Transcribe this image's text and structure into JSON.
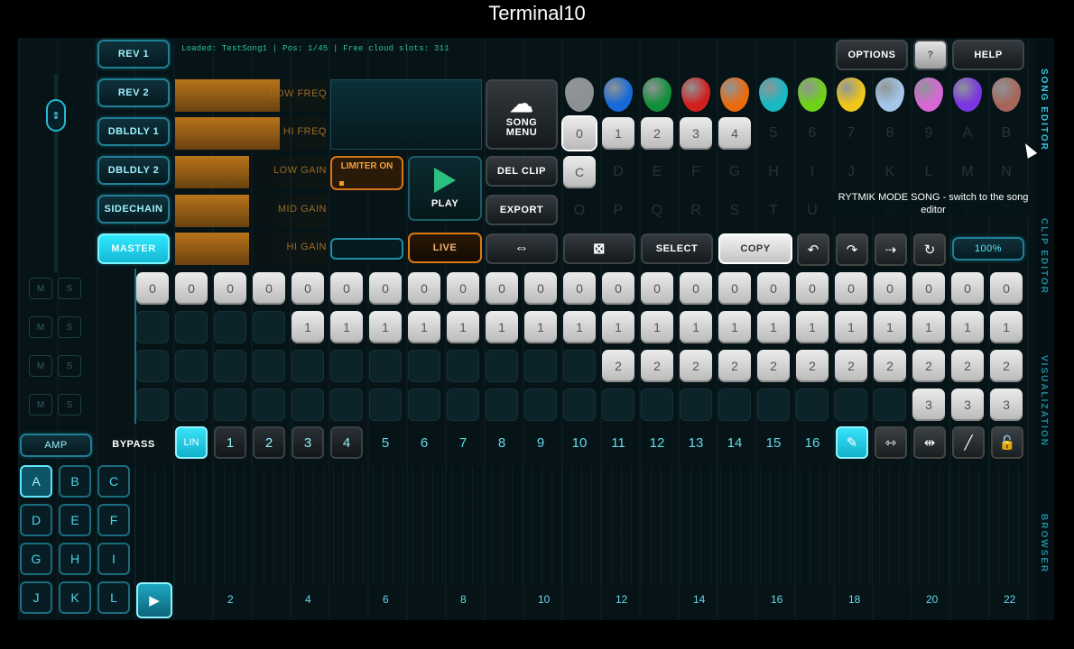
{
  "window_title": "Terminal10",
  "status_line": "Loaded: TestSong1 | Pos: 1/45 | Free cloud slots: 311",
  "effects": [
    "REV 1",
    "REV 2",
    "DBLDLY 1",
    "DBLDLY 2",
    "SIDECHAIN",
    "MASTER"
  ],
  "faders": [
    {
      "label": "LOW FREQ",
      "level": 0.69
    },
    {
      "label": "HI FREQ",
      "level": 0.69
    },
    {
      "label": "LOW GAIN",
      "level": 0.49
    },
    {
      "label": "MID GAIN",
      "level": 0.49
    },
    {
      "label": "HI GAIN",
      "level": 0.49
    }
  ],
  "limiter_label": "LIMITER ON",
  "song_menu": "SONG MENU",
  "play": "PLAY",
  "live": "LIVE",
  "del_clip": "DEL CLIP",
  "export": "EXPORT",
  "options": "OPTIONS",
  "question": "?",
  "help": "HELP",
  "select": "SELECT",
  "copy": "COPY",
  "zoom": "100%",
  "tooltip": "RYTMIK MODE SONG - switch to the song editor",
  "pick_colors": [
    "#8e9194",
    "#1669d8",
    "#138f3a",
    "#d0211f",
    "#ea6a0e",
    "#17b9c3",
    "#6fd11a",
    "#efc619",
    "#a4c6e8",
    "#d867d6",
    "#7a35e0",
    "#a7655a"
  ],
  "clip_row1": [
    "0",
    "1",
    "2",
    "3",
    "4",
    "5",
    "6",
    "7",
    "8",
    "9",
    "A",
    "B"
  ],
  "clip_row2": [
    "C",
    "D",
    "E",
    "F",
    "G",
    "H",
    "I",
    "J",
    "K",
    "L",
    "M",
    "N"
  ],
  "clip_row3": [
    "O",
    "P",
    "Q",
    "R",
    "S",
    "T",
    "U",
    "V",
    "W",
    "X",
    "Y",
    "Z"
  ],
  "row_tracks": [
    {
      "value": "0",
      "start_step": 0
    },
    {
      "value": "1",
      "start_step": 4
    },
    {
      "value": "2",
      "start_step": 12
    },
    {
      "value": "3",
      "start_step": 20
    }
  ],
  "ms": [
    "M",
    "S"
  ],
  "amp": "AMP",
  "bypass": "BYPASS",
  "lin": "LIN",
  "steps": [
    "1",
    "2",
    "3",
    "4",
    "5",
    "6",
    "7",
    "8",
    "9",
    "10",
    "11",
    "12",
    "13",
    "14",
    "15",
    "16"
  ],
  "letters": [
    "A",
    "B",
    "C",
    "D",
    "E",
    "F",
    "G",
    "H",
    "I",
    "J",
    "K",
    "L"
  ],
  "bar_numbers": [
    "2",
    "4",
    "6",
    "8",
    "10",
    "12",
    "14",
    "16",
    "18",
    "20",
    "22"
  ],
  "side_tabs": [
    "SONG EDITOR",
    "CLIP EDITOR",
    "VISUALIZATION",
    "BROWSER"
  ],
  "icons": {
    "undo": "undo-icon",
    "redo": "redo-icon",
    "arrow": "arrow-right-icon",
    "loop": "loop-icon",
    "pen": "pen-icon",
    "expand": "expand-icon",
    "shrink": "shrink-icon",
    "line": "line-icon",
    "lock": "lock-icon"
  },
  "colors": {
    "accent": "#22d3ee",
    "background": "#061418",
    "orange": "#e07a12"
  }
}
